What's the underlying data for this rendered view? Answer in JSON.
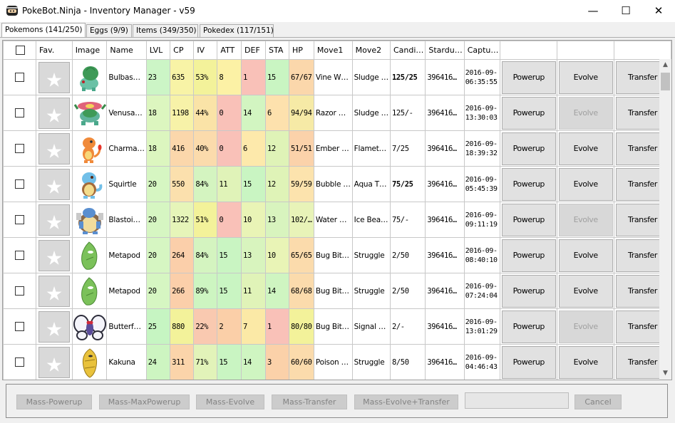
{
  "window": {
    "title": "PokeBot.Ninja - Inventory Manager - v59",
    "minimize_glyph": "—",
    "maximize_glyph": "☐",
    "close_glyph": "✕"
  },
  "tabs": [
    {
      "label": "Pokemons (141/250)",
      "active": true
    },
    {
      "label": "Eggs (9/9)",
      "active": false
    },
    {
      "label": "Items (349/350)",
      "active": false
    },
    {
      "label": "Pokedex (117/151)",
      "active": false
    }
  ],
  "grid": {
    "columns": [
      "",
      "Fav.",
      "Image",
      "Name",
      "LVL",
      "CP",
      "IV",
      "ATT",
      "DEF",
      "STA",
      "HP",
      "Move1",
      "Move2",
      "Candi…",
      "Stardu…",
      "Captu…",
      "",
      "",
      ""
    ],
    "rows": [
      {
        "species": "bulbasaur",
        "name": "Bulbas…",
        "lvl": "23",
        "cp": "635",
        "iv": "53%",
        "att": "8",
        "def": "1",
        "sta": "15",
        "hp": "67/67",
        "move1": "Vine W…",
        "move2": "Sludge …",
        "candy": "125/25",
        "candy_bold": true,
        "stardust": "396416…",
        "captured": "2016-09-\n06:35:55",
        "powerup": "Powerup",
        "evolve": "Evolve",
        "evolve_enabled": true,
        "transfer": "Transfer",
        "colors": {
          "lvl": "#ccf5c6",
          "cp": "#f8f3a6",
          "iv": "#f3f29a",
          "att": "#fcf1a5",
          "def": "#f9c1b8",
          "sta": "#c9f5c2",
          "hp": "#fbd7ab"
        }
      },
      {
        "species": "venusaur",
        "name": "Venusa…",
        "lvl": "18",
        "cp": "1198",
        "iv": "44%",
        "att": "0",
        "def": "14",
        "sta": "6",
        "hp": "94/94",
        "move1": "Razor …",
        "move2": "Sludge …",
        "candy": "125/-",
        "candy_bold": false,
        "stardust": "396416…",
        "captured": "2016-09-\n13:30:03",
        "powerup": "Powerup",
        "evolve": "Evolve",
        "evolve_enabled": false,
        "transfer": "Transfer",
        "colors": {
          "lvl": "#dcf6bf",
          "cp": "#f7f2a8",
          "iv": "#fae3a7",
          "att": "#f9c1b8",
          "def": "#d2f5c1",
          "sta": "#fde1ad",
          "hp": "#f6eaa6"
        }
      },
      {
        "species": "charmander",
        "name": "Charma…",
        "lvl": "18",
        "cp": "416",
        "iv": "40%",
        "att": "0",
        "def": "6",
        "sta": "12",
        "hp": "51/51",
        "move1": "Ember …",
        "move2": "Flamet…",
        "candy": "7/25",
        "candy_bold": false,
        "stardust": "396416…",
        "captured": "2016-09-\n18:39:32",
        "powerup": "Powerup",
        "evolve": "Evolve",
        "evolve_enabled": true,
        "transfer": "Transfer",
        "colors": {
          "lvl": "#dcf6bf",
          "cp": "#fbd7ab",
          "iv": "#fbdbac",
          "att": "#f9c1b8",
          "def": "#fde9ab",
          "sta": "#dff3b7",
          "hp": "#fbd2aa"
        }
      },
      {
        "species": "squirtle",
        "name": "Squirtle",
        "lvl": "20",
        "cp": "550",
        "iv": "84%",
        "att": "11",
        "def": "15",
        "sta": "12",
        "hp": "59/59",
        "move1": "Bubble …",
        "move2": "Aqua T…",
        "candy": "75/25",
        "candy_bold": true,
        "stardust": "396416…",
        "captured": "2016-09-\n05:45:39",
        "powerup": "Powerup",
        "evolve": "Evolve",
        "evolve_enabled": true,
        "transfer": "Transfer",
        "colors": {
          "lvl": "#d6f6c2",
          "cp": "#fbe0ad",
          "iv": "#d4f4c0",
          "att": "#e0f3b8",
          "def": "#c9f5c2",
          "sta": "#dff3b7",
          "hp": "#fce3ad"
        }
      },
      {
        "species": "blastoise",
        "name": "Blastoi…",
        "lvl": "20",
        "cp": "1322",
        "iv": "51%",
        "att": "0",
        "def": "10",
        "sta": "13",
        "hp": "102/…",
        "move1": "Water …",
        "move2": "Ice Bea…",
        "candy": "75/-",
        "candy_bold": false,
        "stardust": "396416…",
        "captured": "2016-09-\n09:11:19",
        "powerup": "Powerup",
        "evolve": "Evolve",
        "evolve_enabled": false,
        "transfer": "Transfer",
        "colors": {
          "lvl": "#d6f6c2",
          "cp": "#e6f5b9",
          "iv": "#f3f29a",
          "att": "#f9c1b8",
          "def": "#e9f4b6",
          "sta": "#d8f4be",
          "hp": "#e8f3b8"
        }
      },
      {
        "species": "metapod",
        "name": "Metapod",
        "lvl": "20",
        "cp": "264",
        "iv": "84%",
        "att": "15",
        "def": "13",
        "sta": "10",
        "hp": "65/65",
        "move1": "Bug Bit…",
        "move2": "Struggle",
        "candy": "2/50",
        "candy_bold": false,
        "stardust": "396416…",
        "captured": "2016-09-\n08:40:10",
        "powerup": "Powerup",
        "evolve": "Evolve",
        "evolve_enabled": true,
        "transfer": "Transfer",
        "colors": {
          "lvl": "#d6f6c2",
          "cp": "#fbcfaa",
          "iv": "#d4f4c0",
          "att": "#c9f5c2",
          "def": "#d8f4be",
          "sta": "#e9f4b6",
          "hp": "#fbdbac"
        }
      },
      {
        "species": "metapod",
        "name": "Metapod",
        "lvl": "20",
        "cp": "266",
        "iv": "89%",
        "att": "15",
        "def": "11",
        "sta": "14",
        "hp": "68/68",
        "move1": "Bug Bit…",
        "move2": "Struggle",
        "candy": "2/50",
        "candy_bold": false,
        "stardust": "396416…",
        "captured": "2016-09-\n07:24:04",
        "powerup": "Powerup",
        "evolve": "Evolve",
        "evolve_enabled": true,
        "transfer": "Transfer",
        "colors": {
          "lvl": "#d6f6c2",
          "cp": "#fbcfaa",
          "iv": "#cdf5c1",
          "att": "#c9f5c2",
          "def": "#e0f3b8",
          "sta": "#cff5c1",
          "hp": "#fbdbac"
        }
      },
      {
        "species": "butterfree",
        "name": "Butterf…",
        "lvl": "25",
        "cp": "880",
        "iv": "22%",
        "att": "2",
        "def": "7",
        "sta": "1",
        "hp": "80/80",
        "move1": "Bug Bit…",
        "move2": "Signal …",
        "candy": "2/-",
        "candy_bold": false,
        "stardust": "396416…",
        "captured": "2016-09-\n13:01:29",
        "powerup": "Powerup",
        "evolve": "Evolve",
        "evolve_enabled": false,
        "transfer": "Transfer",
        "colors": {
          "lvl": "#c6f5c2",
          "cp": "#f3f29a",
          "iv": "#f9c9b0",
          "att": "#fbcfa8",
          "def": "#fbe9a6",
          "sta": "#f9c1b8",
          "hp": "#f3f29a"
        }
      },
      {
        "species": "kakuna",
        "name": "Kakuna",
        "lvl": "24",
        "cp": "311",
        "iv": "71%",
        "att": "15",
        "def": "14",
        "sta": "3",
        "hp": "60/60",
        "move1": "Poison …",
        "move2": "Struggle",
        "candy": "8/50",
        "candy_bold": false,
        "stardust": "396416…",
        "captured": "2016-09-\n04:46:43",
        "powerup": "Powerup",
        "evolve": "Evolve",
        "evolve_enabled": true,
        "transfer": "Transfer",
        "colors": {
          "lvl": "#cdf5c1",
          "cp": "#fbd4aa",
          "iv": "#e2f3b9",
          "att": "#c9f5c2",
          "def": "#cff5c1",
          "sta": "#fbd1a9",
          "hp": "#fbdbac"
        }
      }
    ]
  },
  "scroll": {
    "up_glyph": "▲",
    "down_glyph": "▼"
  },
  "actions": [
    {
      "label": "Mass-Powerup"
    },
    {
      "label": "Mass-MaxPowerup"
    },
    {
      "label": "Mass-Evolve"
    },
    {
      "label": "Mass-Transfer"
    },
    {
      "label": "Mass-Evolve+Transfer"
    },
    {
      "label": "Cancel"
    }
  ],
  "star_glyph": "★"
}
